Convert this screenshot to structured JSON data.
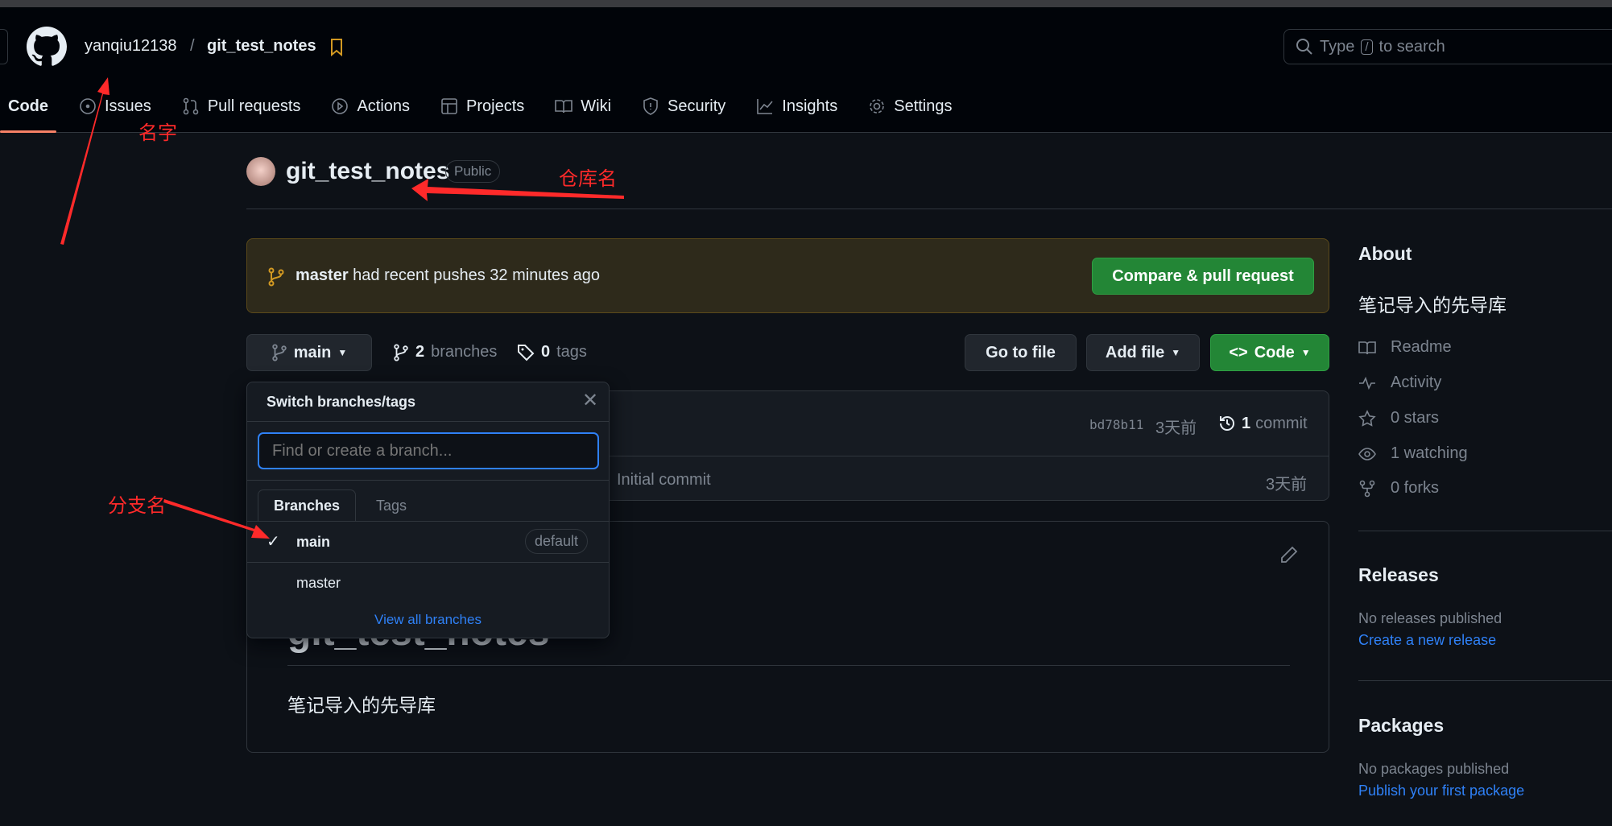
{
  "header": {
    "owner": "yanqiu12138",
    "separator": "/",
    "repo": "git_test_notes",
    "search_prefix": "Type",
    "search_key": "/",
    "search_suffix": "to search"
  },
  "nav": [
    {
      "label": "Code",
      "icon": "code-icon"
    },
    {
      "label": "Issues",
      "icon": "issue-icon"
    },
    {
      "label": "Pull requests",
      "icon": "pull-request-icon"
    },
    {
      "label": "Actions",
      "icon": "play-icon"
    },
    {
      "label": "Projects",
      "icon": "table-icon"
    },
    {
      "label": "Wiki",
      "icon": "book-icon"
    },
    {
      "label": "Security",
      "icon": "shield-icon"
    },
    {
      "label": "Insights",
      "icon": "graph-icon"
    },
    {
      "label": "Settings",
      "icon": "gear-icon"
    }
  ],
  "repo": {
    "title": "git_test_notes",
    "visibility": "Public"
  },
  "banner": {
    "branch": "master",
    "text": "had recent pushes 32 minutes ago",
    "button": "Compare & pull request"
  },
  "toolbar": {
    "branch": "main",
    "branches_count": "2",
    "branches_label": "branches",
    "tags_count": "0",
    "tags_label": "tags",
    "go_to_file": "Go to file",
    "add_file": "Add file",
    "code": "Code"
  },
  "commit": {
    "hash": "bd78b11",
    "time": "3天前",
    "count": "1",
    "count_label": "commit",
    "file_message": "Initial commit",
    "file_time": "3天前"
  },
  "readme": {
    "heading": "git_test_notes",
    "body": "笔记导入的先导库"
  },
  "dropdown": {
    "title": "Switch branches/tags",
    "placeholder": "Find or create a branch...",
    "tabs": [
      "Branches",
      "Tags"
    ],
    "branches": [
      {
        "name": "main",
        "badge": "default",
        "selected": true
      },
      {
        "name": "master"
      }
    ],
    "view_all": "View all branches"
  },
  "about": {
    "title": "About",
    "description": "笔记导入的先导库",
    "items": [
      "Readme",
      "Activity",
      "0 stars",
      "1 watching",
      "0 forks"
    ]
  },
  "releases": {
    "title": "Releases",
    "none": "No releases published",
    "link": "Create a new release"
  },
  "packages": {
    "title": "Packages",
    "none": "No packages published",
    "link": "Publish your first package"
  },
  "annotations": {
    "name": "名字",
    "repo": "仓库名",
    "branch": "分支名"
  },
  "colors": {
    "accent": "#2f81f7",
    "green": "#238636",
    "annotation": "#ff2a2a",
    "tab_underline": "#f78166"
  }
}
